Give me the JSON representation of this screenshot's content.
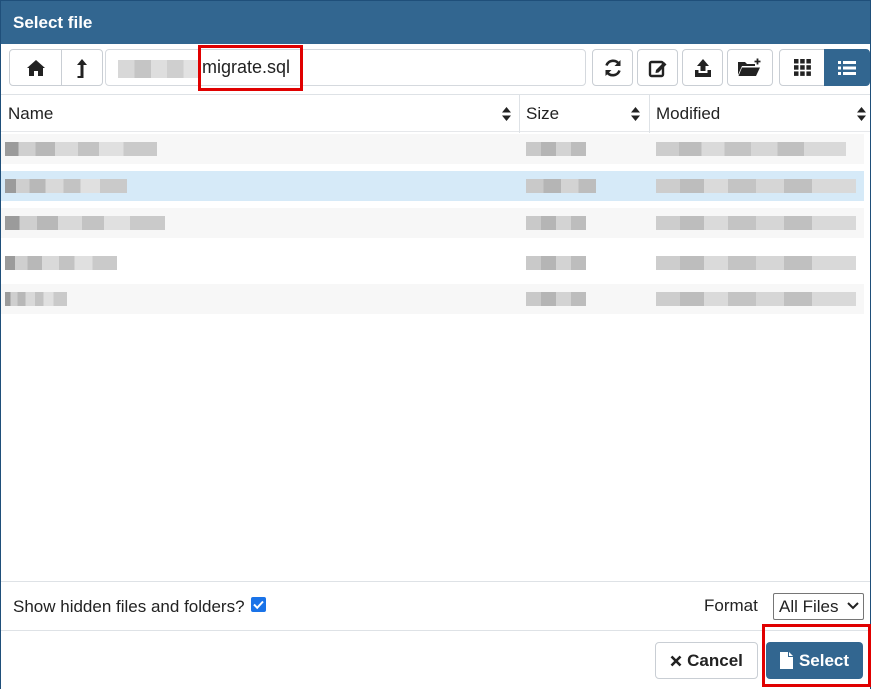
{
  "dialog": {
    "title": "Select file"
  },
  "toolbar": {
    "path_visible_text": "migrate.sql",
    "buttons": [
      "home-icon",
      "parent-folder-icon",
      "refresh-icon",
      "rename-icon",
      "upload-icon",
      "new-folder-icon",
      "grid-view-icon",
      "list-view-icon"
    ]
  },
  "table": {
    "columns": [
      "Name",
      "Size",
      "Modified"
    ],
    "rows": [
      {
        "state": "alt"
      },
      {
        "state": "selected"
      },
      {
        "state": "alt"
      },
      {
        "state": "normal"
      },
      {
        "state": "alt"
      }
    ]
  },
  "footer": {
    "show_hidden_label": "Show hidden files and folders?",
    "show_hidden_checked": true,
    "format_label": "Format",
    "format_value": "All Files",
    "cancel_label": "Cancel",
    "select_label": "Select"
  },
  "colors": {
    "accent": "#326690",
    "selected_row": "#d6eaf8",
    "highlight": "#e00000"
  }
}
